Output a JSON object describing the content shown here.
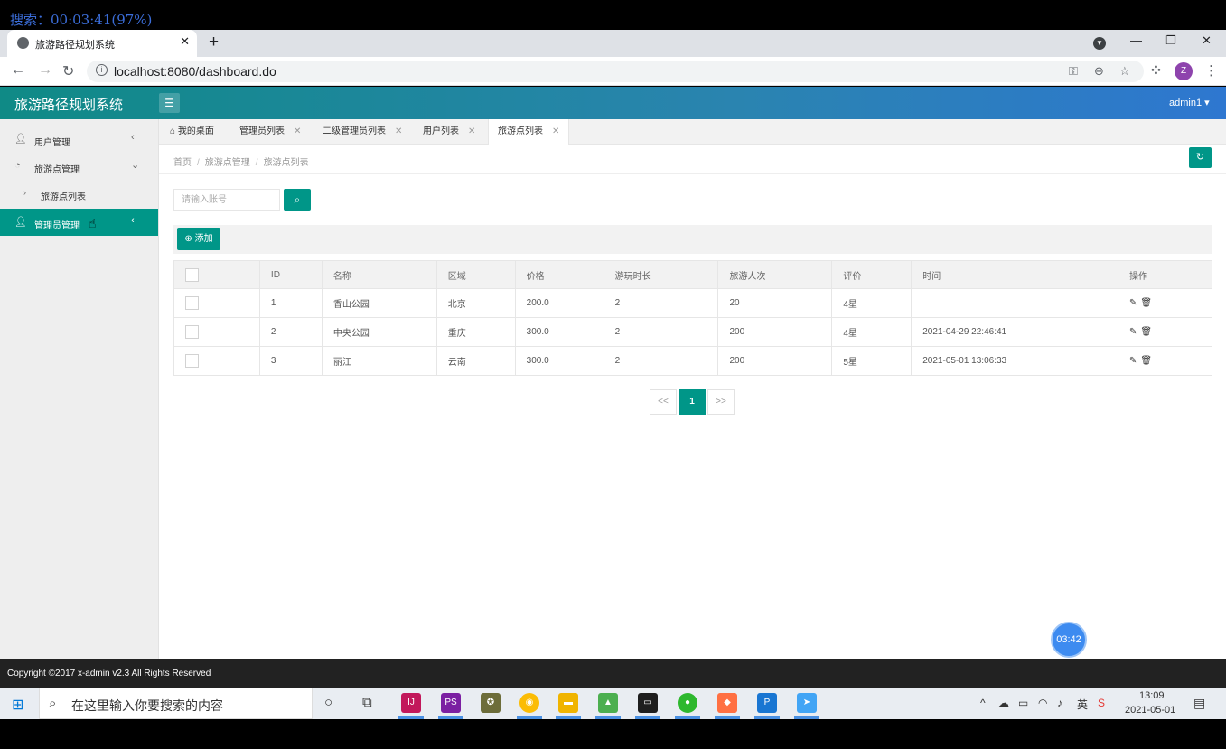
{
  "recording": {
    "text": "搜索：00:03:41(97%)"
  },
  "browser": {
    "tab_title": "旅游路径规划系统",
    "url": "localhost:8080/dashboard.do",
    "profile_initial": "Z"
  },
  "app": {
    "logo": "旅游路径规划系统",
    "user": "admin1",
    "accent": "#009688"
  },
  "sidebar": {
    "items": [
      {
        "label": "用户管理"
      },
      {
        "label": "旅游点管理"
      },
      {
        "label": "旅游点列表"
      },
      {
        "label": "管理员管理"
      }
    ]
  },
  "page_tabs": [
    {
      "label": "我的桌面"
    },
    {
      "label": "管理员列表"
    },
    {
      "label": "二级管理员列表"
    },
    {
      "label": "用户列表"
    },
    {
      "label": "旅游点列表"
    }
  ],
  "breadcrumb": [
    "首页",
    "旅游点管理",
    "旅游点列表"
  ],
  "search": {
    "placeholder": "请输入账号"
  },
  "toolbar": {
    "add_label": "添加"
  },
  "table": {
    "headers": [
      "ID",
      "名称",
      "区域",
      "价格",
      "游玩时长",
      "旅游人次",
      "评价",
      "时间",
      "操作"
    ],
    "rows": [
      [
        "1",
        "香山公园",
        "北京",
        "200.0",
        "2",
        "20",
        "4星",
        ""
      ],
      [
        "2",
        "中央公园",
        "重庆",
        "300.0",
        "2",
        "200",
        "4星",
        "2021-04-29 22:46:41"
      ],
      [
        "3",
        "丽江",
        "云南",
        "300.0",
        "2",
        "200",
        "5星",
        "2021-05-01 13:06:33"
      ]
    ]
  },
  "pager": {
    "prev": "<<",
    "current": "1",
    "next": ">>"
  },
  "timer": "03:42",
  "footer": "Copyright ©2017 x-admin v2.3 All Rights Reserved",
  "taskbar": {
    "search_text": "在这里输入你要搜索的内容",
    "time": "13:09",
    "date": "2021-05-01"
  }
}
